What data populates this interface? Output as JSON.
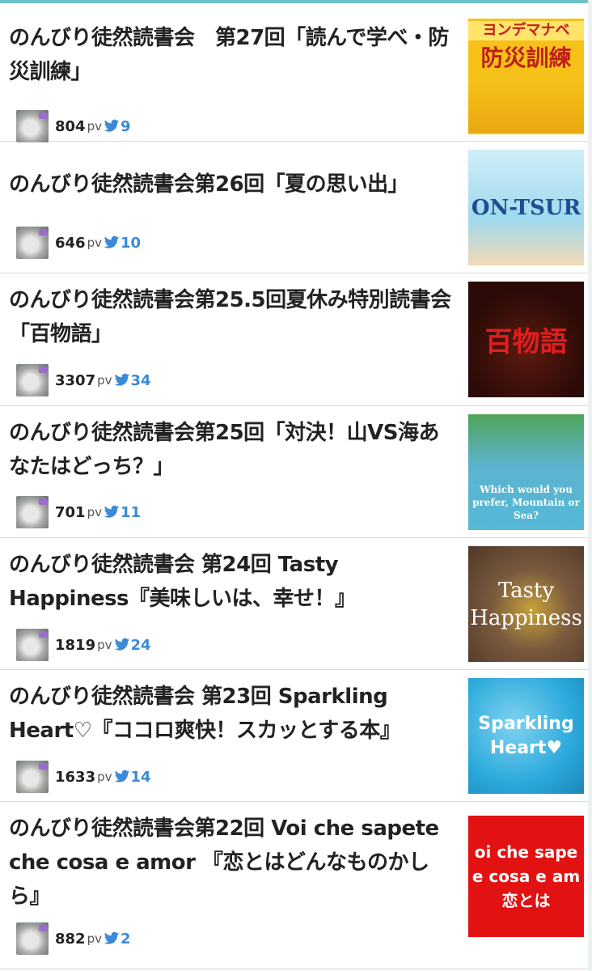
{
  "items": [
    {
      "title": "のんびり徒然読書会　第27回「読んで学べ・防災訓練」",
      "pv": "804",
      "pv_unit": "pv",
      "tweets": "9",
      "thumb": {
        "text": "防災訓練",
        "bg": "#f6c21a",
        "fg": "#c21d1d"
      }
    },
    {
      "title": "のんびり徒然読書会第26回「夏の思い出」",
      "pv": "646",
      "pv_unit": "pv",
      "tweets": "10",
      "thumb": {
        "text": "ON-TSUR",
        "bg": "#bfe7f3",
        "fg": "#1f4d8f"
      }
    },
    {
      "title": "のんびり徒然読書会第25.5回夏休み特別読書会「百物語」",
      "pv": "3307",
      "pv_unit": "pv",
      "tweets": "34",
      "thumb": {
        "text": "百物語",
        "bg": "#2b0a07",
        "fg": "#e01e1e"
      }
    },
    {
      "title": "のんびり徒然読書会第25回「対決！山VS海あなたはどっち？」",
      "pv": "701",
      "pv_unit": "pv",
      "tweets": "11",
      "thumb": {
        "text": "Which would you prefer, Mountain or Sea?",
        "bg": "#56b9d6",
        "fg": "#ffffff"
      }
    },
    {
      "title": "のんびり徒然読書会 第24回 Tasty Happiness『美味しいは、幸せ！』",
      "pv": "1819",
      "pv_unit": "pv",
      "tweets": "24",
      "thumb": {
        "text": "Tasty Happiness",
        "bg": "#6b4c36",
        "fg": "#ffffff"
      }
    },
    {
      "title": "のんびり徒然読書会 第23回 Sparkling Heart♡『ココロ爽快！スカッとする本』",
      "pv": "1633",
      "pv_unit": "pv",
      "tweets": "14",
      "thumb": {
        "text": "Sparkling Heart♥",
        "bg": "#2ba9db",
        "fg": "#ffffff"
      }
    },
    {
      "title": "のんびり徒然読書会第22回 Voi che sapete che cosa e amor 『恋とはどんなものかしら』",
      "pv": "882",
      "pv_unit": "pv",
      "tweets": "2",
      "thumb": {
        "text": "oi che sape e cosa e am 恋とは",
        "bg": "#e31212",
        "fg": "#ffffff"
      }
    }
  ]
}
